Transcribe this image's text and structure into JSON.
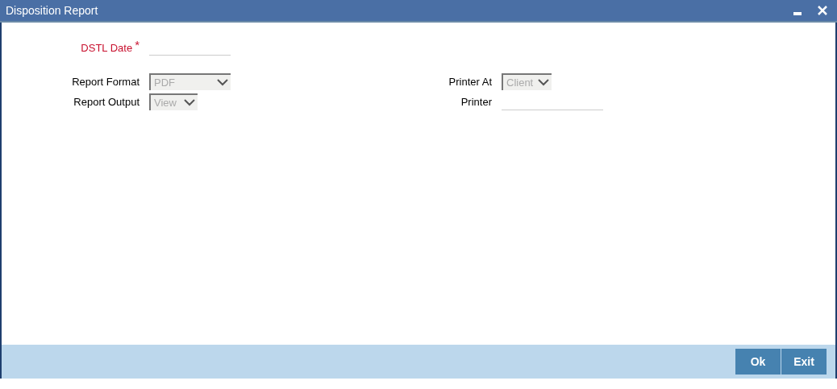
{
  "window": {
    "title": "Disposition Report"
  },
  "date_field": {
    "label": "DSTL Date",
    "required_mark": "*"
  },
  "left_fields": [
    {
      "label": "Report Format",
      "kind": "select",
      "value": "PDF",
      "disabled": true
    },
    {
      "label": "Report Output",
      "kind": "select",
      "value": "View",
      "disabled": true
    }
  ],
  "right_fields": [
    {
      "label": "Printer At",
      "kind": "select",
      "value": "Client",
      "disabled": true
    },
    {
      "label": "Printer",
      "kind": "text",
      "disabled": false
    }
  ],
  "buttons": [
    "Ok",
    "Exit"
  ]
}
